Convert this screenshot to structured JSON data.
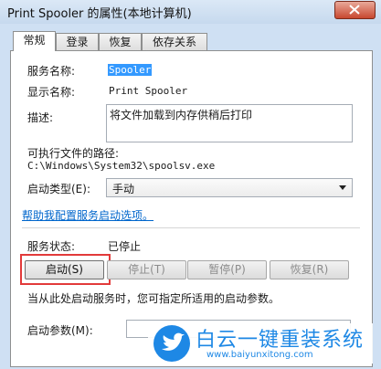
{
  "window": {
    "title": "Print Spooler 的属性(本地计算机)"
  },
  "tabs": [
    {
      "label": "常规"
    },
    {
      "label": "登录"
    },
    {
      "label": "恢复"
    },
    {
      "label": "依存关系"
    }
  ],
  "general": {
    "service_name_label": "服务名称:",
    "service_name_value": "Spooler",
    "display_name_label": "显示名称:",
    "display_name_value": "Print Spooler",
    "description_label": "描述:",
    "description_value": "将文件加载到内存供稍后打印",
    "exe_path_label": "可执行文件的路径:",
    "exe_path_value": "C:\\Windows\\System32\\spoolsv.exe",
    "startup_type_label": "启动类型(E):",
    "startup_type_value": "手动",
    "help_link": "帮助我配置服务启动选项。",
    "status_label": "服务状态:",
    "status_value": "已停止",
    "start_button": "启动(S)",
    "stop_button": "停止(T)",
    "pause_button": "暂停(P)",
    "resume_button": "恢复(R)",
    "hint": "当从此处启动服务时，您可指定所适用的启动参数。",
    "params_label": "启动参数(M):",
    "params_value": ""
  },
  "watermark": {
    "title": "白云一键重装系统",
    "url": "www.baiyunxitong.com"
  },
  "colors": {
    "highlight": "#e23a3a",
    "link": "#0066cc",
    "watermark_blue": "#1e88e5"
  }
}
